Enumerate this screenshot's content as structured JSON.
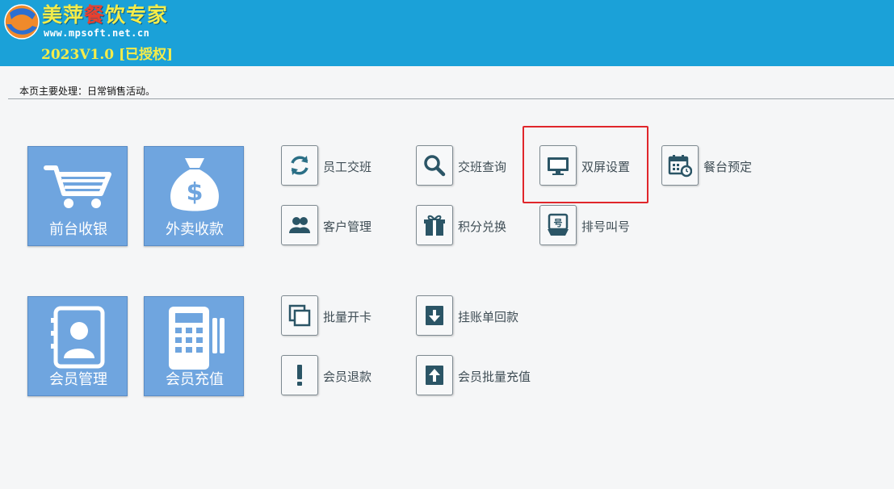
{
  "header": {
    "brand_part1": "美萍",
    "brand_part2": "餐",
    "brand_part3": "饮专家",
    "url": "www.mpsoft.net.cn",
    "version": "2023V1.0 [已授权]"
  },
  "info_bar": {
    "text": "本页主要处理：日常销售活动。"
  },
  "big_tiles": [
    {
      "label": "前台收银",
      "icon": "shopping-cart-icon"
    },
    {
      "label": "外卖收款",
      "icon": "money-bag-icon"
    },
    {
      "label": "会员管理",
      "icon": "member-card-icon"
    },
    {
      "label": "会员充值",
      "icon": "pos-terminal-icon"
    }
  ],
  "small_items": [
    {
      "label": "员工交班",
      "icon": "refresh-icon"
    },
    {
      "label": "交班查询",
      "icon": "search-icon"
    },
    {
      "label": "双屏设置",
      "icon": "monitor-icon"
    },
    {
      "label": "餐台预定",
      "icon": "calendar-clock-icon"
    },
    {
      "label": "客户管理",
      "icon": "users-icon"
    },
    {
      "label": "积分兑换",
      "icon": "gift-icon"
    },
    {
      "label": "排号叫号",
      "icon": "queue-number-icon"
    },
    {
      "label": "批量开卡",
      "icon": "copy-cards-icon"
    },
    {
      "label": "挂账单回款",
      "icon": "download-icon"
    },
    {
      "label": "会员退款",
      "icon": "exclamation-icon"
    },
    {
      "label": "会员批量充值",
      "icon": "upload-icon"
    }
  ],
  "colors": {
    "header_bg": "#1ba1d8",
    "brand_yellow": "#f4ec4a",
    "brand_red": "#e8402f",
    "tile_blue": "#6fa5df",
    "highlight_red": "#e0262b"
  }
}
